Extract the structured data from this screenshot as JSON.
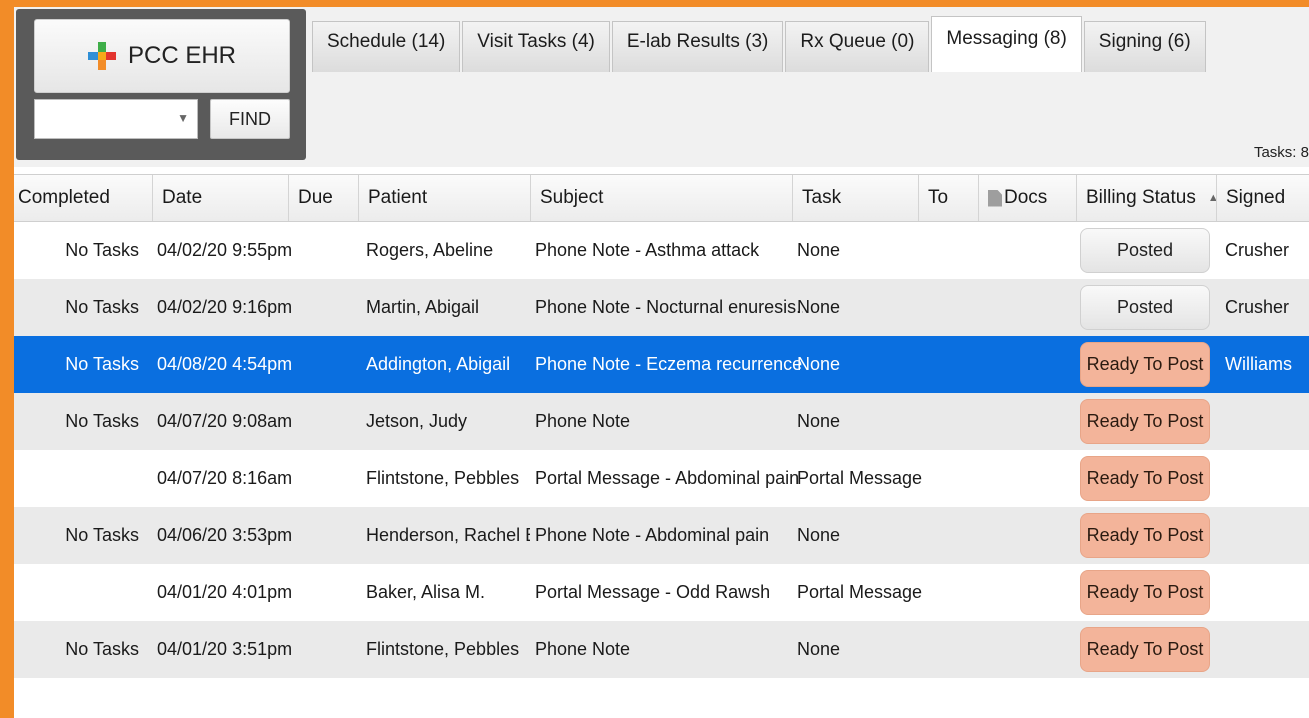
{
  "app": {
    "logo_text": "PCC EHR",
    "find_label": "FIND",
    "search_value": ""
  },
  "tabs": [
    {
      "label": "Schedule (14)",
      "active": false
    },
    {
      "label": "Visit Tasks (4)",
      "active": false
    },
    {
      "label": "E-lab Results (3)",
      "active": false
    },
    {
      "label": "Rx Queue (0)",
      "active": false
    },
    {
      "label": "Messaging (8)",
      "active": true
    },
    {
      "label": "Signing (6)",
      "active": false
    }
  ],
  "tasks_count": "Tasks: 8",
  "table": {
    "headers": [
      "Completed",
      "Date",
      "Due",
      "Patient",
      "Subject",
      "Task",
      "To",
      "Docs",
      "Billing Status",
      "Signed"
    ],
    "rows": [
      {
        "completed": "No Tasks",
        "date": "04/02/20 9:55pm",
        "due": "",
        "patient": "Rogers, Abeline",
        "subject": "Phone Note - Asthma attack",
        "task": "None",
        "to": "",
        "docs": "",
        "billing": "Posted",
        "signed": "Crusher"
      },
      {
        "completed": "No Tasks",
        "date": "04/02/20 9:16pm",
        "due": "",
        "patient": "Martin, Abigail",
        "subject": "Phone Note - Nocturnal enuresis...",
        "task": "None",
        "to": "",
        "docs": "",
        "billing": "Posted",
        "signed": "Crusher"
      },
      {
        "completed": "No Tasks",
        "date": "04/08/20 4:54pm",
        "due": "",
        "patient": "Addington, Abigail",
        "subject": "Phone Note - Eczema recurrence",
        "task": "None",
        "to": "",
        "docs": "",
        "billing": "Ready To Post",
        "signed": "Williams"
      },
      {
        "completed": "No Tasks",
        "date": "04/07/20 9:08am",
        "due": "",
        "patient": "Jetson, Judy",
        "subject": "Phone Note",
        "task": "None",
        "to": "",
        "docs": "",
        "billing": "Ready To Post",
        "signed": ""
      },
      {
        "completed": "",
        "date": "04/07/20 8:16am",
        "due": "",
        "patient": "Flintstone, Pebbles",
        "subject": "Portal Message - Abdominal pain",
        "task": "Portal Message",
        "to": "",
        "docs": "",
        "billing": "Ready To Post",
        "signed": ""
      },
      {
        "completed": "No Tasks",
        "date": "04/06/20 3:53pm",
        "due": "",
        "patient": "Henderson, Rachel E.",
        "subject": "Phone Note - Abdominal pain",
        "task": "None",
        "to": "",
        "docs": "",
        "billing": "Ready To Post",
        "signed": ""
      },
      {
        "completed": "",
        "date": "04/01/20 4:01pm",
        "due": "",
        "patient": "Baker, Alisa M.",
        "subject": "Portal Message - Odd Rawsh",
        "task": "Portal Message",
        "to": "",
        "docs": "",
        "billing": "Ready To Post",
        "signed": ""
      },
      {
        "completed": "No Tasks",
        "date": "04/01/20 3:51pm",
        "due": "",
        "patient": "Flintstone, Pebbles",
        "subject": "Phone Note",
        "task": "None",
        "to": "",
        "docs": "",
        "billing": "Ready To Post",
        "signed": ""
      }
    ]
  },
  "colors": {
    "accent_border": "#f28c28",
    "selected_row": "#0a6fe0",
    "ready_pill": "#f3b49a",
    "posted_pill": "#eeeeee"
  }
}
